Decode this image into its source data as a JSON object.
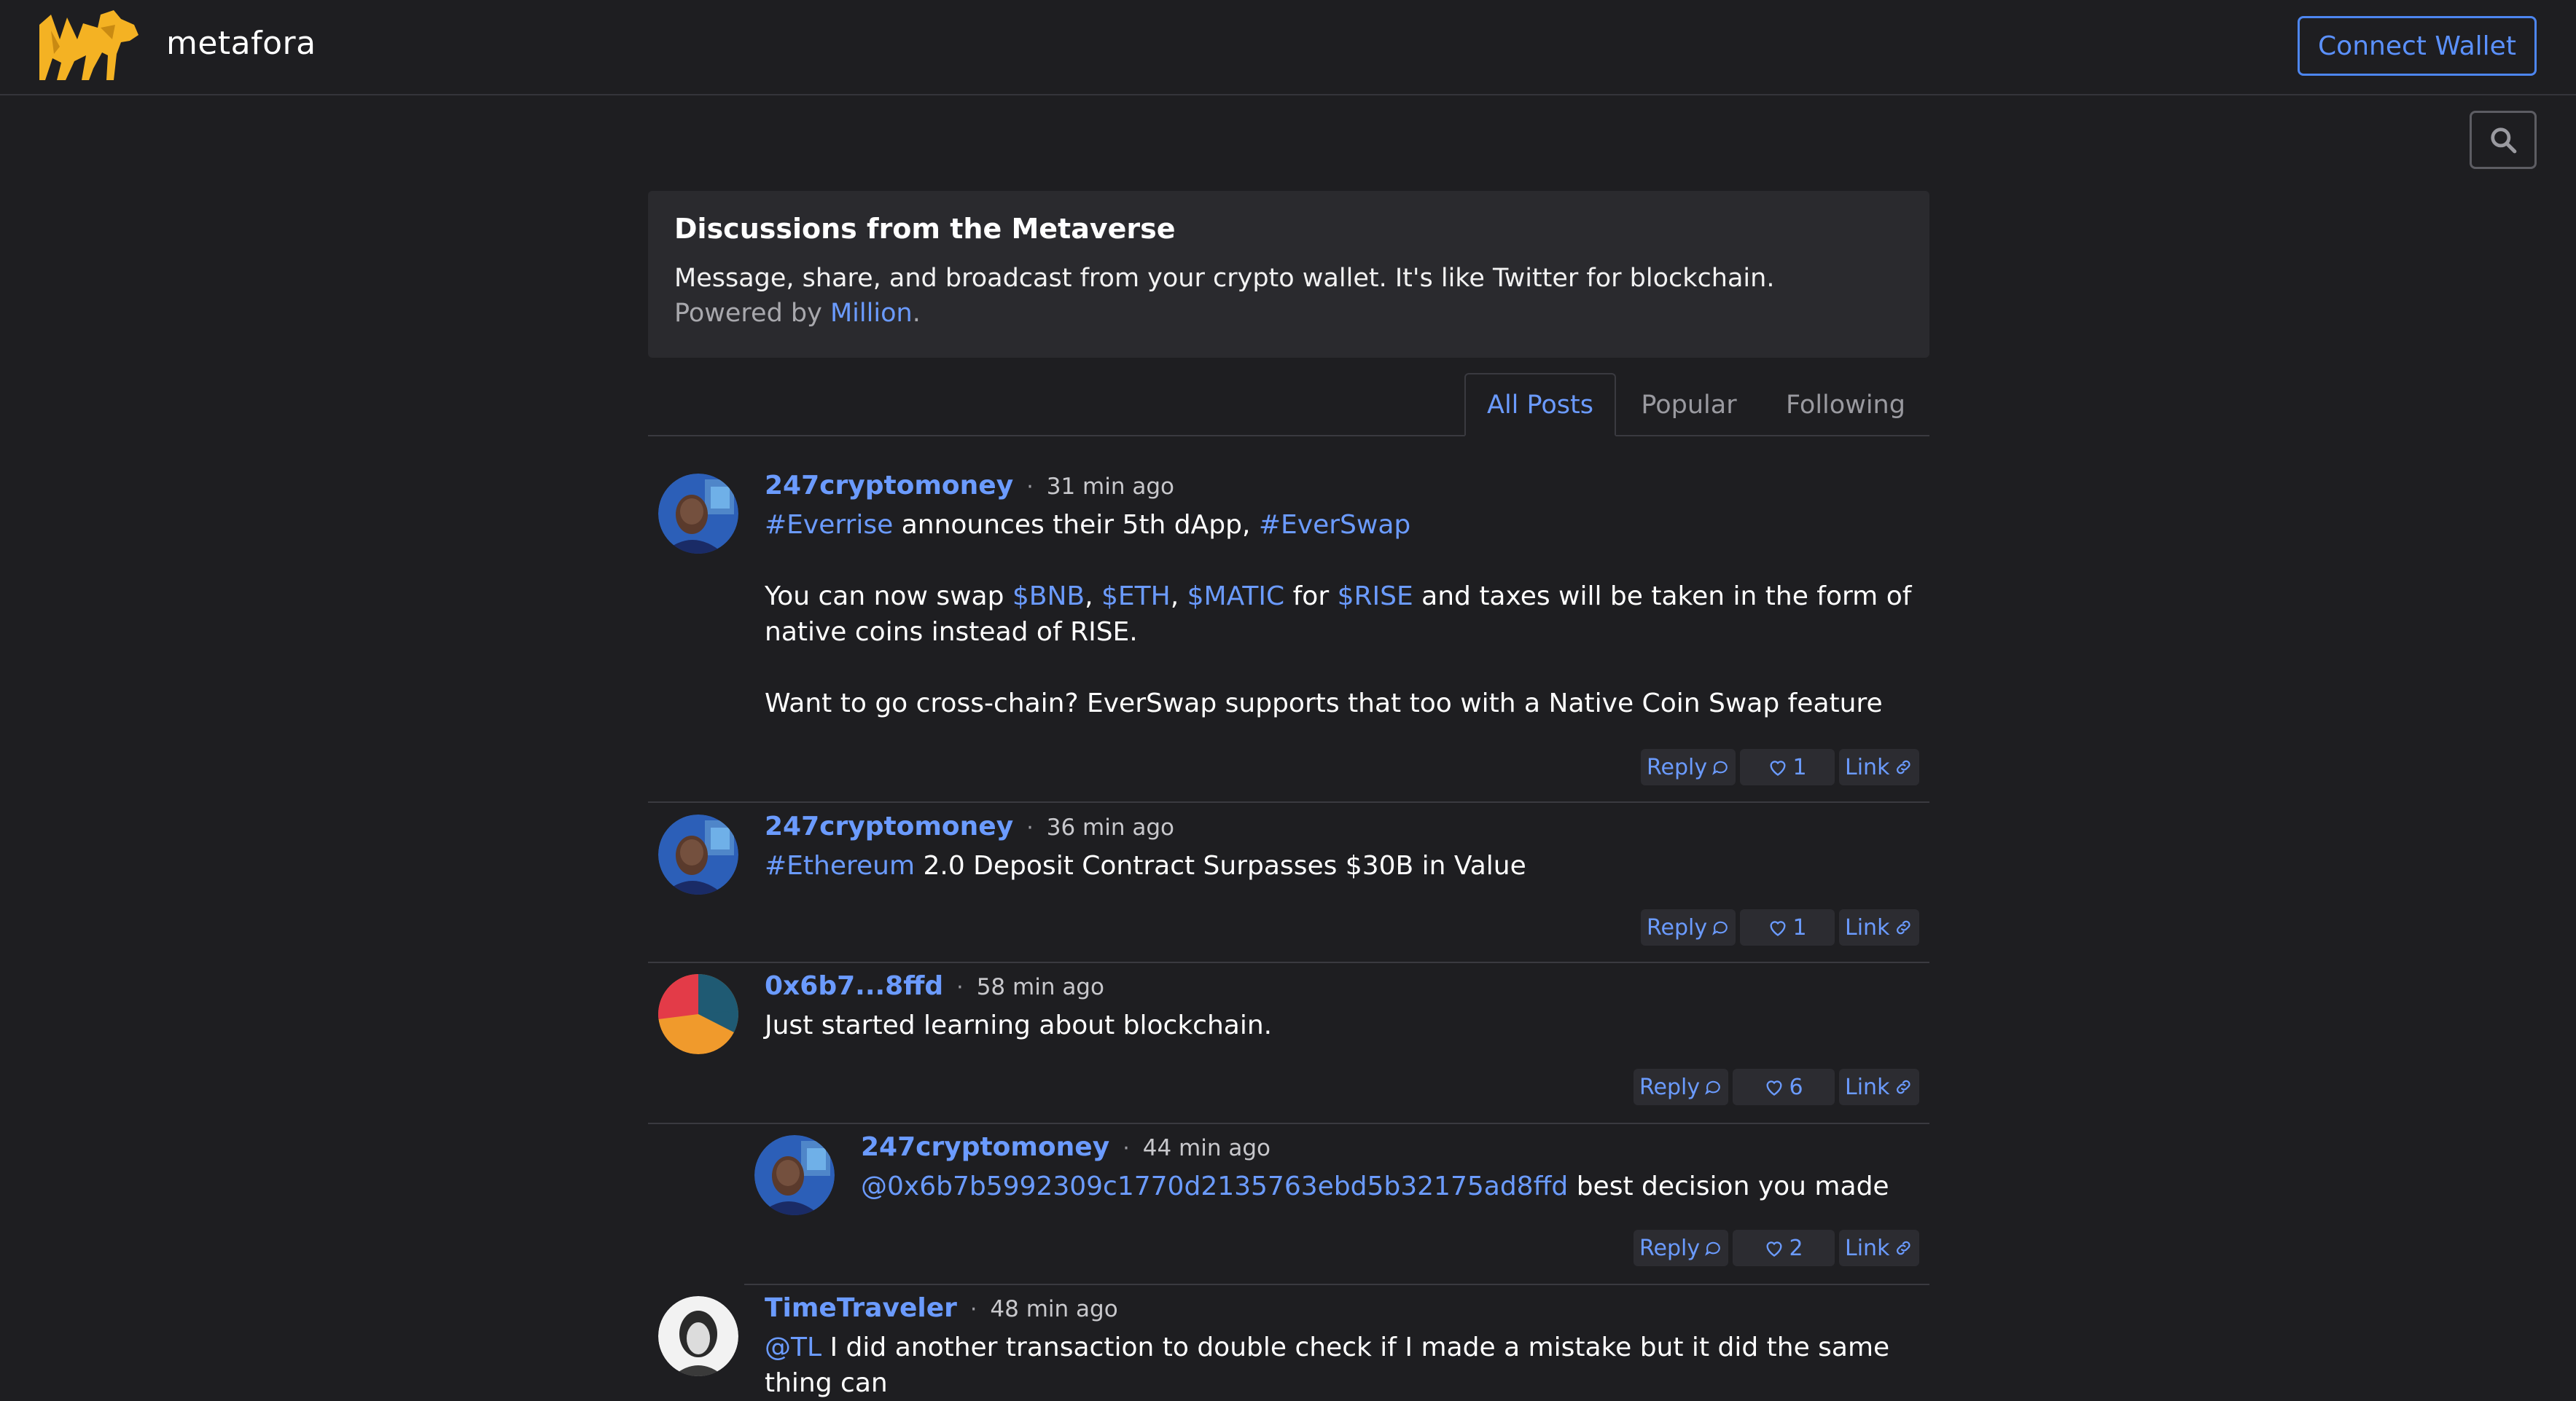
{
  "app": {
    "brand": "metafora",
    "connect_label": "Connect Wallet"
  },
  "intro": {
    "title": "Discussions from the Metaverse",
    "description": "Message, share, and broadcast from your crypto wallet. It's like Twitter for blockchain.",
    "powered_prefix": "Powered by ",
    "powered_link": "Million",
    "powered_suffix": "."
  },
  "tabs": [
    {
      "label": "All Posts",
      "active": true
    },
    {
      "label": "Popular",
      "active": false
    },
    {
      "label": "Following",
      "active": false
    }
  ],
  "actions": {
    "reply": "Reply",
    "link": "Link"
  },
  "posts": [
    {
      "author": "247cryptomoney",
      "time": "31 min ago",
      "likes": "1",
      "avatar": "photo-portrait",
      "body": [
        [
          {
            "t": "#Everrise",
            "tag": true
          },
          {
            "t": " announces their 5th dApp, "
          },
          {
            "t": "#EverSwap",
            "tag": true
          }
        ],
        [],
        [
          {
            "t": "You can now swap "
          },
          {
            "t": "$BNB",
            "tag": true
          },
          {
            "t": ", "
          },
          {
            "t": "$ETH",
            "tag": true
          },
          {
            "t": ", "
          },
          {
            "t": "$MATIC",
            "tag": true
          },
          {
            "t": " for "
          },
          {
            "t": "$RISE",
            "tag": true
          },
          {
            "t": " and taxes will be taken in the form of native coins instead of RISE."
          }
        ],
        [],
        [
          {
            "t": "Want to go cross-chain? EverSwap supports that too with a Native Coin Swap feature"
          }
        ]
      ]
    },
    {
      "author": "247cryptomoney",
      "time": "36 min ago",
      "likes": "1",
      "avatar": "photo-portrait",
      "body": [
        [
          {
            "t": "#Ethereum",
            "tag": true
          },
          {
            "t": " 2.0 Deposit Contract Surpasses $30B in Value"
          }
        ]
      ]
    },
    {
      "author": "0x6b7...8ffd",
      "time": "58 min ago",
      "likes": "6",
      "avatar": "pie-identicon",
      "body": [
        [
          {
            "t": "Just started learning about blockchain."
          }
        ]
      ]
    },
    {
      "author": "247cryptomoney",
      "time": "44 min ago",
      "likes": "2",
      "avatar": "photo-portrait",
      "reply": true,
      "body": [
        [
          {
            "t": "@0x6b7b5992309c1770d2135763ebd5b32175ad8ffd",
            "tag": true
          },
          {
            "t": " best decision you made"
          }
        ]
      ]
    },
    {
      "author": "TimeTraveler",
      "time": "48 min ago",
      "avatar": "sketch-portrait",
      "body": [
        [
          {
            "t": "@TL",
            "tag": true
          },
          {
            "t": " I did another transaction to double check if I made a mistake but it did the same thing can"
          }
        ]
      ]
    }
  ],
  "colors": {
    "background": "#1e1e21",
    "card": "#2a2a2e",
    "accent": "#6b9bff",
    "logo": "#f4b223"
  }
}
